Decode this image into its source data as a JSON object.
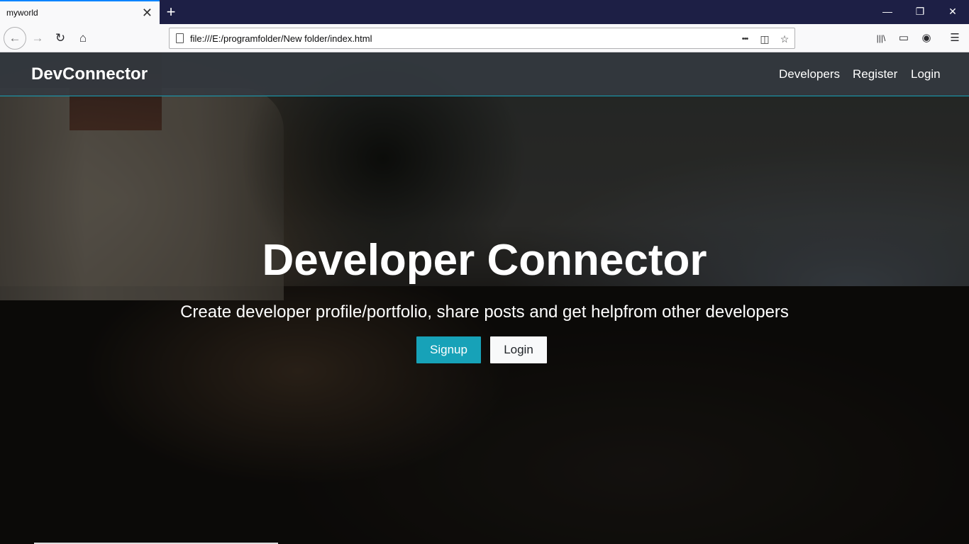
{
  "browser": {
    "tab_title": "myworld",
    "tab_close": "✕",
    "new_tab": "+",
    "window_controls": {
      "minimize": "—",
      "restore": "❐",
      "close": "✕"
    },
    "url": "file:///E:/programfolder/New folder/index.html",
    "nav_icons": {
      "back": "←",
      "forward": "→",
      "reload": "↻",
      "home": "⌂"
    },
    "url_actions": {
      "more": "•••",
      "pocket": "◫",
      "bookmark": "☆"
    },
    "toolbar_icons": {
      "library": "|||\\",
      "sidebar": "▭",
      "account": "◉",
      "menu": "☰"
    }
  },
  "site": {
    "brand": "DevConnector",
    "nav_links": [
      "Developers",
      "Register",
      "Login"
    ],
    "accent_color": "#17a2b8",
    "landing": {
      "title": "Developer Connector",
      "lead": "Create developer profile/portfolio, share posts and get helpfrom other developers",
      "signup_label": "Signup",
      "login_label": "Login"
    }
  }
}
